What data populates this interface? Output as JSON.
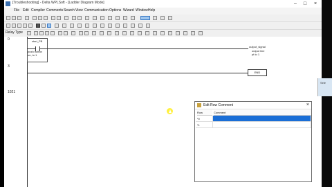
{
  "window": {
    "title": "[Troubleshooting] - Delta WPLSoft - [Ladder Diagram Mode]",
    "controls": [
      "–",
      "□",
      "×"
    ]
  },
  "menu": [
    "File",
    "Edit",
    "Compiler",
    "Comments",
    "Search",
    "View",
    "Communication",
    "Options",
    "Wizard",
    "Window",
    "Help"
  ],
  "toolbar3": {
    "relay_type_label": "Relay Type"
  },
  "ladder": {
    "row_numbers": [
      "0",
      "3",
      "1021"
    ],
    "contact": {
      "name": "start_PB",
      "desc1": "push button",
      "desc2": "on, to 1"
    },
    "coil": {
      "name": "output_signal",
      "desc1": "output line",
      "desc2": "pt to 1"
    },
    "end_label": "END"
  },
  "dialog": {
    "title": "Edit Row Comment",
    "close": "×",
    "columns": [
      "Row",
      "Comment"
    ],
    "rows": [
      {
        "row": "*0",
        "comment": ""
      },
      {
        "row": "*1",
        "comment": ""
      }
    ]
  },
  "side_preview_text": "Sele"
}
